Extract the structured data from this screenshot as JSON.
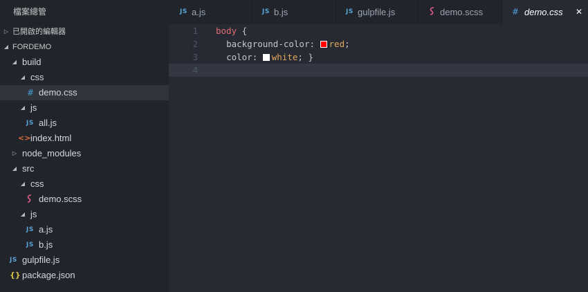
{
  "sidebar": {
    "title": "檔案總管",
    "open_editors_label": "已開啟的編輯器",
    "project_label": "FORDEMO",
    "tree": [
      {
        "label": "build",
        "kind": "folder",
        "expanded": true
      },
      {
        "label": "css",
        "kind": "folder",
        "expanded": true
      },
      {
        "label": "demo.css",
        "kind": "file",
        "icon": "css-file-icon",
        "selected": true
      },
      {
        "label": "js",
        "kind": "folder",
        "expanded": true
      },
      {
        "label": "all.js",
        "kind": "file",
        "icon": "js-file-icon"
      },
      {
        "label": "index.html",
        "kind": "file",
        "icon": "html-file-icon"
      },
      {
        "label": "node_modules",
        "kind": "folder",
        "expanded": false
      },
      {
        "label": "src",
        "kind": "folder",
        "expanded": true
      },
      {
        "label": "css",
        "kind": "folder",
        "expanded": true
      },
      {
        "label": "demo.scss",
        "kind": "file",
        "icon": "scss-file-icon"
      },
      {
        "label": "js",
        "kind": "folder",
        "expanded": true
      },
      {
        "label": "a.js",
        "kind": "file",
        "icon": "js-file-icon"
      },
      {
        "label": "b.js",
        "kind": "file",
        "icon": "js-file-icon"
      },
      {
        "label": "gulpfile.js",
        "kind": "file",
        "icon": "js-file-icon"
      },
      {
        "label": "package.json",
        "kind": "file",
        "icon": "json-file-icon"
      }
    ]
  },
  "icons": {
    "js": "JS",
    "css": "#",
    "html": "<>",
    "json": "{}",
    "folder_open": "◢",
    "folder_closed": "▷",
    "close": "✕"
  },
  "tabs": [
    {
      "label": "a.js",
      "icon": "js-file-icon",
      "active": false
    },
    {
      "label": "b.js",
      "icon": "js-file-icon",
      "active": false
    },
    {
      "label": "gulpfile.js",
      "icon": "js-file-icon",
      "active": false
    },
    {
      "label": "demo.scss",
      "icon": "scss-file-icon",
      "active": false
    },
    {
      "label": "demo.css",
      "icon": "css-file-icon",
      "active": true
    }
  ],
  "editor": {
    "line_numbers": [
      "1",
      "2",
      "3",
      "4"
    ],
    "current_line": 4,
    "lines": {
      "l1_selector": "body",
      "l1_brace": " {",
      "l2_indent": "  ",
      "l2_prop": "background-color:",
      "l2_value": "red",
      "l2_end": ";",
      "l3_indent": "  ",
      "l3_prop": "color:",
      "l3_value": "white",
      "l3_end": "; }"
    },
    "swatch_colors": {
      "red": "#ff0000",
      "white": "#ffffff"
    }
  },
  "colors": {
    "sidebar_bg": "#21252b",
    "editor_bg": "#272a33",
    "selected_row": "#2f343d",
    "selector": "#e06c75",
    "value": "#e0a85c"
  }
}
